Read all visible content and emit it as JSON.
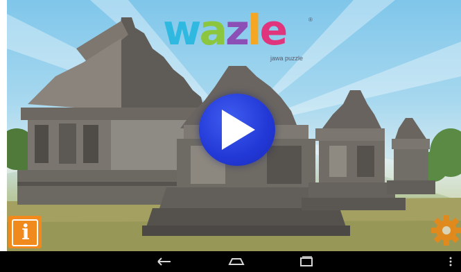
{
  "game": {
    "logo_letters": [
      {
        "char": "w",
        "color": "#2fb8e0"
      },
      {
        "char": "a",
        "color": "#8cc63f"
      },
      {
        "char": "z",
        "color": "#8c4fb5"
      },
      {
        "char": "l",
        "color": "#f5a623"
      },
      {
        "char": "e",
        "color": "#e0347c"
      }
    ],
    "subtitle": "jawa puzzle",
    "registered_mark": "®",
    "info_glyph": "i"
  },
  "buttons": {
    "play": {
      "icon": "play-icon",
      "color": "#2238d6"
    },
    "info": {
      "icon": "info-icon",
      "color": "#f08a1c"
    },
    "settings": {
      "icon": "gear-icon",
      "color": "#e08a1e"
    }
  },
  "nav_bar": {
    "items": [
      {
        "icon": "back-icon"
      },
      {
        "icon": "home-icon"
      },
      {
        "icon": "recent-apps-icon"
      },
      {
        "icon": "overflow-menu-icon"
      }
    ]
  }
}
